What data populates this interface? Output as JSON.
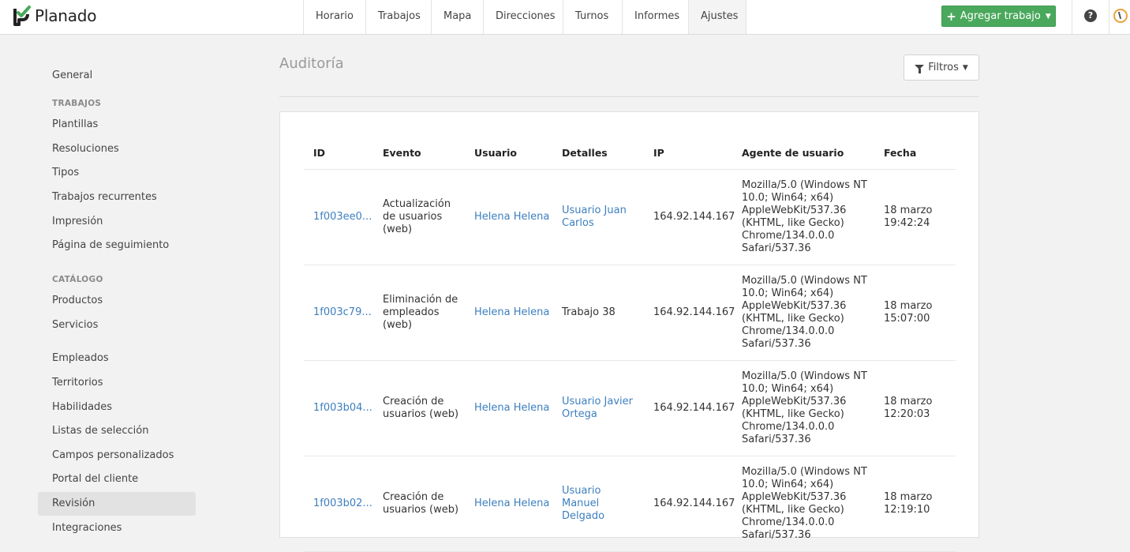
{
  "app": {
    "logo_text": "Planado",
    "logo_icon": "planado-check-icon"
  },
  "nav": {
    "items": [
      "Horario",
      "Trabajos",
      "Mapa",
      "Direcciones",
      "Turnos",
      "Informes",
      "Ajustes"
    ],
    "active": "Ajustes"
  },
  "header": {
    "add_button_label": "Agregar trabajo",
    "help_icon": "question-icon",
    "accent_color": "#4aa85c"
  },
  "sidebar": {
    "general": "General",
    "section_trabajos": "TRABAJOS",
    "trabajos_items": [
      "Plantillas",
      "Resoluciones",
      "Tipos",
      "Trabajos recurrentes",
      "Impresión",
      "Página de seguimiento"
    ],
    "section_catalogo": "CATÁLOGO",
    "catalogo_items": [
      "Productos",
      "Servicios"
    ],
    "other_items": [
      "Empleados",
      "Territorios",
      "Habilidades",
      "Listas de selección",
      "Campos personalizados",
      "Portal del cliente",
      "Revisión",
      "Integraciones"
    ],
    "active": "Revisión"
  },
  "main": {
    "title": "Auditoría",
    "filter_label": "Filtros",
    "table": {
      "headers": [
        "ID",
        "Evento",
        "Usuario",
        "Detalles",
        "IP",
        "Agente de usuario",
        "Fecha"
      ],
      "rows": [
        {
          "id": "1f003ee0...",
          "event": [
            "Actualización",
            "de usuarios",
            "(web)"
          ],
          "user": "Helena Helena",
          "details": [
            "Usuario Juan",
            "Carlos"
          ],
          "details_link": true,
          "ip": "164.92.144.167",
          "agent": [
            "Mozilla/5.0 (Windows NT",
            "10.0; Win64; x64)",
            "AppleWebKit/537.36",
            "(KHTML, like Gecko)",
            "Chrome/134.0.0.0",
            "Safari/537.36"
          ],
          "date": [
            "18 marzo",
            "19:42:24"
          ]
        },
        {
          "id": "1f003c79...",
          "event": [
            "Eliminación de",
            "empleados",
            "(web)"
          ],
          "user": "Helena Helena",
          "details": [
            "Trabajo 38"
          ],
          "details_link": false,
          "ip": "164.92.144.167",
          "agent": [
            "Mozilla/5.0 (Windows NT",
            "10.0; Win64; x64)",
            "AppleWebKit/537.36",
            "(KHTML, like Gecko)",
            "Chrome/134.0.0.0",
            "Safari/537.36"
          ],
          "date": [
            "18 marzo",
            "15:07:00"
          ]
        },
        {
          "id": "1f003b04...",
          "event": [
            "Creación de",
            "usuarios (web)"
          ],
          "user": "Helena Helena",
          "details": [
            "Usuario Javier",
            "Ortega"
          ],
          "details_link": true,
          "ip": "164.92.144.167",
          "agent": [
            "Mozilla/5.0 (Windows NT",
            "10.0; Win64; x64)",
            "AppleWebKit/537.36",
            "(KHTML, like Gecko)",
            "Chrome/134.0.0.0",
            "Safari/537.36"
          ],
          "date": [
            "18 marzo",
            "12:20:03"
          ]
        },
        {
          "id": "1f003b02...",
          "event": [
            "Creación de",
            "usuarios (web)"
          ],
          "user": "Helena Helena",
          "details": [
            "Usuario",
            "Manuel",
            "Delgado"
          ],
          "details_link": true,
          "ip": "164.92.144.167",
          "agent": [
            "Mozilla/5.0 (Windows NT",
            "10.0; Win64; x64)",
            "AppleWebKit/537.36",
            "(KHTML, like Gecko)",
            "Chrome/134.0.0.0",
            "Safari/537.36"
          ],
          "date": [
            "18 marzo",
            "12:19:10"
          ]
        }
      ]
    }
  }
}
